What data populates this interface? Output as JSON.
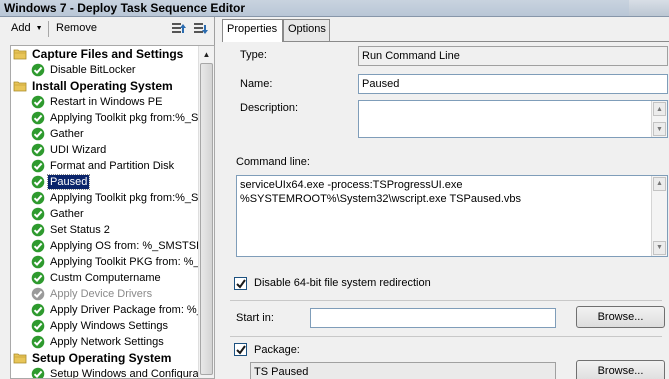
{
  "window": {
    "title": "Windows 7 - Deploy Task Sequence Editor"
  },
  "toolbar": {
    "add_label": "Add",
    "remove_label": "Remove"
  },
  "tree": {
    "items": [
      {
        "kind": "group",
        "label": "Capture Files and Settings"
      },
      {
        "kind": "step",
        "label": "Disable BitLocker",
        "status": "ok"
      },
      {
        "kind": "group",
        "label": "Install Operating System"
      },
      {
        "kind": "step",
        "label": "Restart in Windows PE",
        "status": "ok"
      },
      {
        "kind": "step",
        "label": "Applying Toolkit pkg from:%_SM",
        "status": "ok"
      },
      {
        "kind": "step",
        "label": "Gather",
        "status": "ok"
      },
      {
        "kind": "step",
        "label": "UDI Wizard",
        "status": "ok"
      },
      {
        "kind": "step",
        "label": "Format and Partition Disk",
        "status": "ok"
      },
      {
        "kind": "step",
        "label": "Paused",
        "status": "ok",
        "selected": true
      },
      {
        "kind": "step",
        "label": "Applying Toolkit pkg from:%_SM",
        "status": "ok"
      },
      {
        "kind": "step",
        "label": "Gather",
        "status": "ok"
      },
      {
        "kind": "step",
        "label": "Set Status 2",
        "status": "ok"
      },
      {
        "kind": "step",
        "label": "Applying OS from: %_SMSTSH",
        "status": "ok"
      },
      {
        "kind": "step",
        "label": "Applying Toolkit PKG from: %_S",
        "status": "ok"
      },
      {
        "kind": "step",
        "label": "Custm Computername",
        "status": "ok"
      },
      {
        "kind": "step",
        "label": "Apply Device Drivers",
        "status": "disabled"
      },
      {
        "kind": "step",
        "label": "Apply Driver Package from: %_",
        "status": "ok"
      },
      {
        "kind": "step",
        "label": "Apply Windows Settings",
        "status": "ok"
      },
      {
        "kind": "step",
        "label": "Apply Network Settings",
        "status": "ok"
      },
      {
        "kind": "group",
        "label": "Setup Operating System"
      },
      {
        "kind": "step",
        "label": "Setup Windows and Configurat",
        "status": "ok"
      }
    ]
  },
  "tabs": {
    "properties": "Properties",
    "options": "Options"
  },
  "props": {
    "type_label": "Type:",
    "type_value": "Run Command Line",
    "name_label": "Name:",
    "name_value": "Paused",
    "description_label": "Description:",
    "description_value": "",
    "command_label": "Command line:",
    "command_value": "serviceUIx64.exe -process:TSProgressUI.exe %SYSTEMROOT%\\System32\\wscript.exe TSPaused.vbs",
    "disable64_label": "Disable 64-bit file system redirection",
    "disable64_checked": true,
    "startin_label": "Start in:",
    "startin_value": "",
    "browse_label": "Browse...",
    "package_label": "Package:",
    "package_checked": true,
    "package_value": "TS Paused",
    "browse2_label": "Browse..."
  },
  "colors": {
    "ok": "#2e9a2e",
    "disabled": "#9a9a9a",
    "folder": "#e8c558",
    "selection": "#0a246a"
  }
}
